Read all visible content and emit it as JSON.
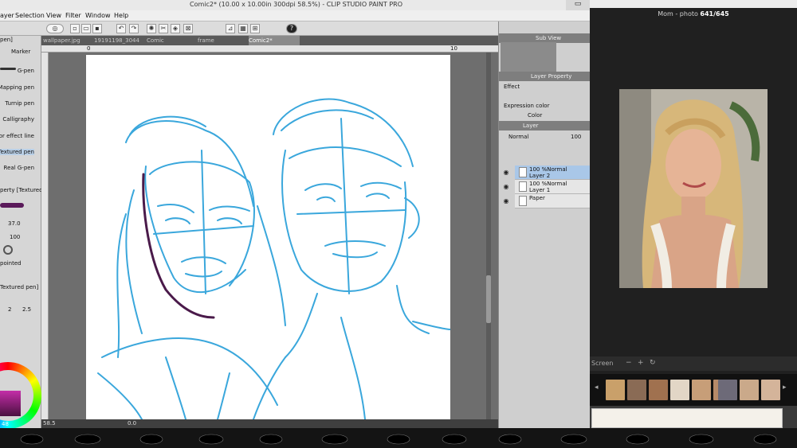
{
  "app": {
    "title": "Comic2* (10.00 x 10.00in 300dpi 58.5%) - CLIP STUDIO PAINT PRO",
    "window_controls": "▭"
  },
  "menu": [
    "ayer",
    "Selection",
    "View",
    "Filter",
    "Window",
    "Help"
  ],
  "toolbar": {
    "help_label": "?"
  },
  "tabs": [
    "wallpaper.jpg",
    "19191198_3044",
    "Comic",
    "frame",
    "Comic2*"
  ],
  "left_panel": {
    "header_label": "pen]",
    "tool_label": "Marker",
    "brushes": [
      "G-pen",
      "Mapping pen",
      "Turnip pen",
      "Calligraphy",
      "For effect line",
      "Textured pen",
      "Real G-pen"
    ],
    "property_label": "perty [Textured pen]",
    "size_value": "37.0",
    "opacity_value": "100",
    "tip_label": "pointed",
    "sub_label": "Textured pen]",
    "stab_values": [
      "2",
      "2.5"
    ],
    "bottom_value": "48"
  },
  "ruler": {
    "start": "0",
    "end": "10"
  },
  "status": {
    "zoom": "58.5",
    "rotation": "0.0"
  },
  "right_panel": {
    "sub_view_label": "Sub View",
    "layer_property_label": "Layer Property",
    "effect_label": "Effect",
    "expression_color_label": "Expression color",
    "color_label": "Color",
    "layer_tab_label": "Layer",
    "blend_mode": "Normal",
    "opacity": "100",
    "layers": [
      {
        "line1": "100 %Normal",
        "line2": "Layer 2",
        "selected": true
      },
      {
        "line1": "100 %Normal",
        "line2": "Layer 1",
        "selected": false
      },
      {
        "line1": "",
        "line2": "Paper",
        "selected": false
      }
    ]
  },
  "viewer": {
    "title_prefix": "Mom - photo",
    "counter": "641/645",
    "screen_label": "Screen"
  },
  "colors": {
    "sketch_stroke": "#3aa7dc",
    "brush_stroke": "#4a1a4a",
    "canvas_bg": "#6e6e6e",
    "selected_layer": "#a9c7e8"
  }
}
